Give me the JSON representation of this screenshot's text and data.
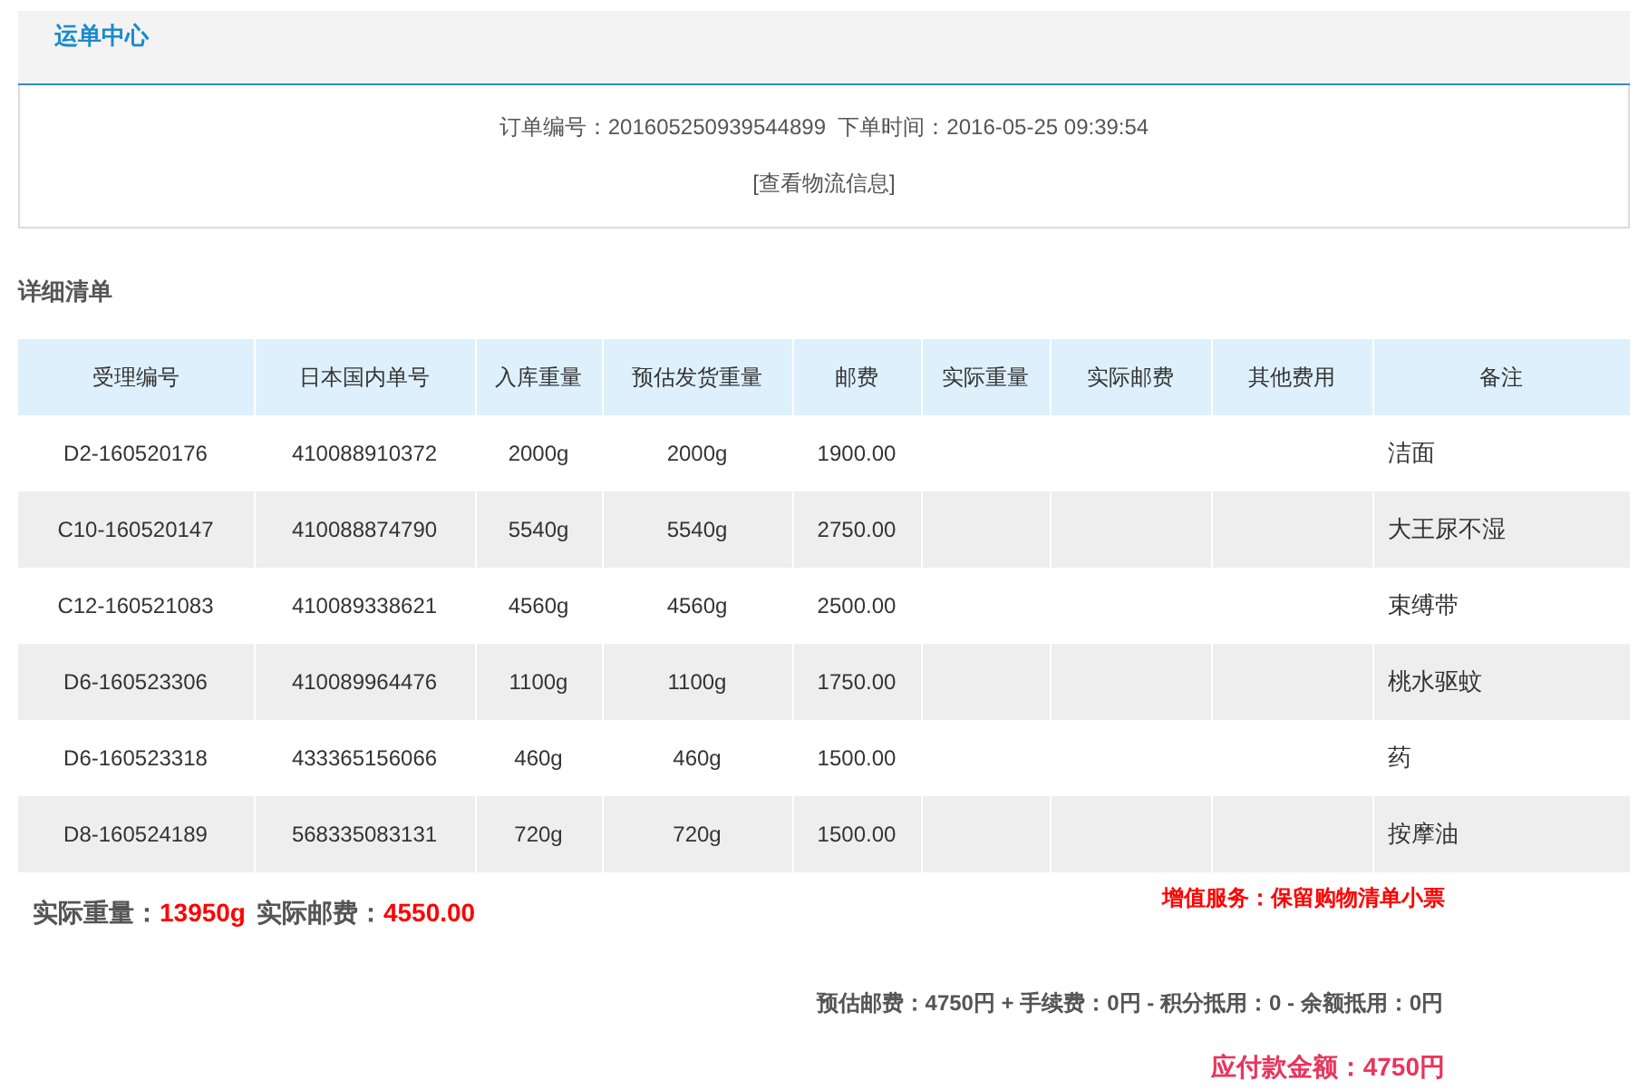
{
  "header": {
    "title": "运单中心"
  },
  "order": {
    "info": "订单编号：201605250939544899  下单时间：2016-05-25 09:39:54",
    "link": "[查看物流信息]"
  },
  "section_title": "详细清单",
  "table": {
    "columns": [
      "受理编号",
      "日本国内单号",
      "入库重量",
      "预估发货重量",
      "邮费",
      "实际重量",
      "实际邮费",
      "其他费用",
      "备注"
    ],
    "rows": [
      [
        "D2-160520176",
        "410088910372",
        "2000g",
        "2000g",
        "1900.00",
        "",
        "",
        "",
        "洁面"
      ],
      [
        "C10-160520147",
        "410088874790",
        "5540g",
        "5540g",
        "2750.00",
        "",
        "",
        "",
        "大王尿不湿"
      ],
      [
        "C12-160521083",
        "410089338621",
        "4560g",
        "4560g",
        "2500.00",
        "",
        "",
        "",
        "束缚带"
      ],
      [
        "D6-160523306",
        "410089964476",
        "1100g",
        "1100g",
        "1750.00",
        "",
        "",
        "",
        "桃水驱蚊"
      ],
      [
        "D6-160523318",
        "433365156066",
        "460g",
        "460g",
        "1500.00",
        "",
        "",
        "",
        "药"
      ],
      [
        "D8-160524189",
        "568335083131",
        "720g",
        "720g",
        "1500.00",
        "",
        "",
        "",
        "按摩油"
      ]
    ]
  },
  "totals": [
    {
      "label": "实际重量：",
      "value": "13950g"
    },
    {
      "label": "实际邮费：",
      "value": "4550.00"
    }
  ],
  "service": "增值服务：保留购物清单小票",
  "fee_breakdown": "预估邮费：4750円 + 手续费：0円 - 积分抵用：0 - 余额抵用：0円",
  "amount_due": "应付款金额：4750円"
}
